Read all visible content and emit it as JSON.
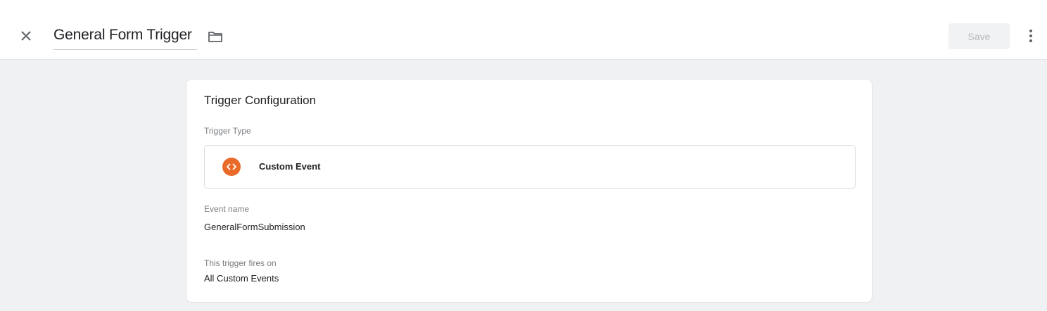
{
  "header": {
    "title": "General Form Trigger",
    "save_label": "Save",
    "icons": {
      "close": "close-icon",
      "folder": "folder-icon",
      "more": "more-vert-icon"
    }
  },
  "card": {
    "title": "Trigger Configuration",
    "trigger_type_label": "Trigger Type",
    "trigger_type_value": "Custom Event",
    "trigger_type_icon": "code-icon",
    "trigger_type_icon_color": "#ea6a2a",
    "event_name_label": "Event name",
    "event_name_value": "GeneralFormSubmission",
    "fires_on_label": "This trigger fires on",
    "fires_on_value": "All Custom Events"
  }
}
